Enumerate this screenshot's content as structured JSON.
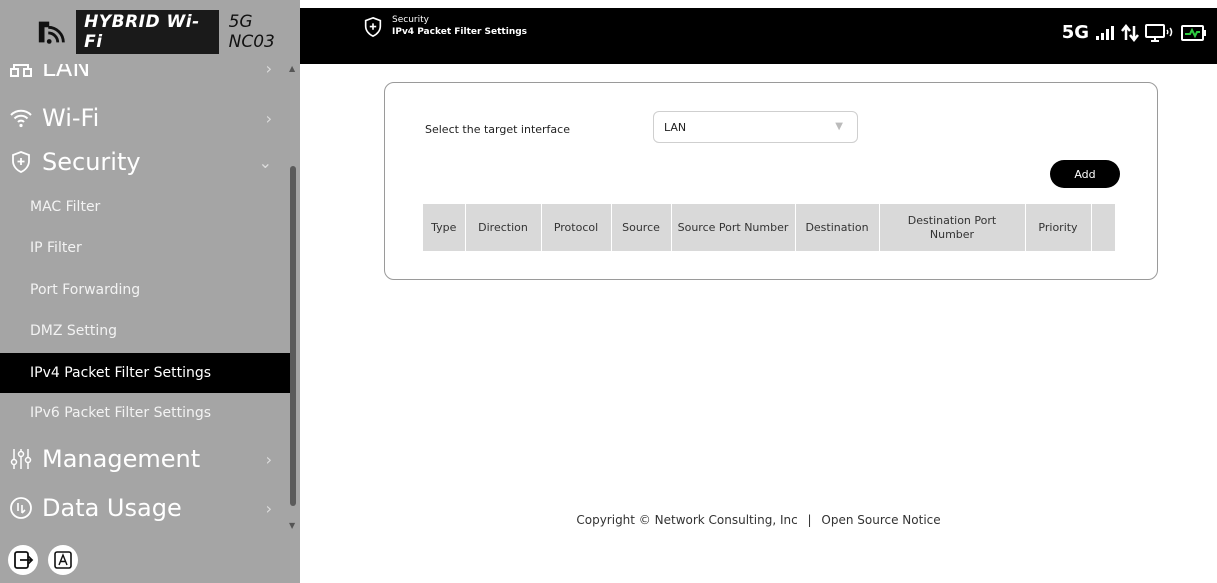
{
  "brand": {
    "hybrid": "HYBRID Wi-Fi",
    "model": "5G NC03"
  },
  "topbar": {
    "section": "Security",
    "page": "IPv4 Packet Filter Settings",
    "network": "5G",
    "icons": [
      "signal-bars-icon",
      "data-arrows-icon",
      "connected-device-icon",
      "battery-charging-icon"
    ]
  },
  "sidebar": {
    "main": [
      {
        "label": "LAN",
        "icon": "lan-icon"
      },
      {
        "label": "Wi-Fi",
        "icon": "wifi-icon"
      },
      {
        "label": "Security",
        "icon": "shield-plus-icon",
        "expanded": true
      },
      {
        "label": "Management",
        "icon": "sliders-icon"
      },
      {
        "label": "Data Usage",
        "icon": "data-usage-icon"
      }
    ],
    "security_sub": [
      "MAC Filter",
      "IP Filter",
      "Port Forwarding",
      "DMZ Setting",
      "IPv4 Packet Filter Settings",
      "IPv6 Packet Filter Settings"
    ],
    "active_sub": "IPv4 Packet Filter Settings"
  },
  "content": {
    "interface_label": "Select the target interface",
    "interface_value": "LAN",
    "add_label": "Add",
    "columns": [
      "Type",
      "Direction",
      "Protocol",
      "Source",
      "Source Port Number",
      "Destination",
      "Destination Port Number",
      "Priority",
      ""
    ]
  },
  "footer": {
    "copyright": "Copyright © Network Consulting, Inc",
    "separator": "|",
    "notice": "Open Source Notice"
  },
  "colors": {
    "sidebar": "#a5a5a5",
    "active": "#000000",
    "topbar": "#000000",
    "table_header": "#d9d9d9"
  }
}
